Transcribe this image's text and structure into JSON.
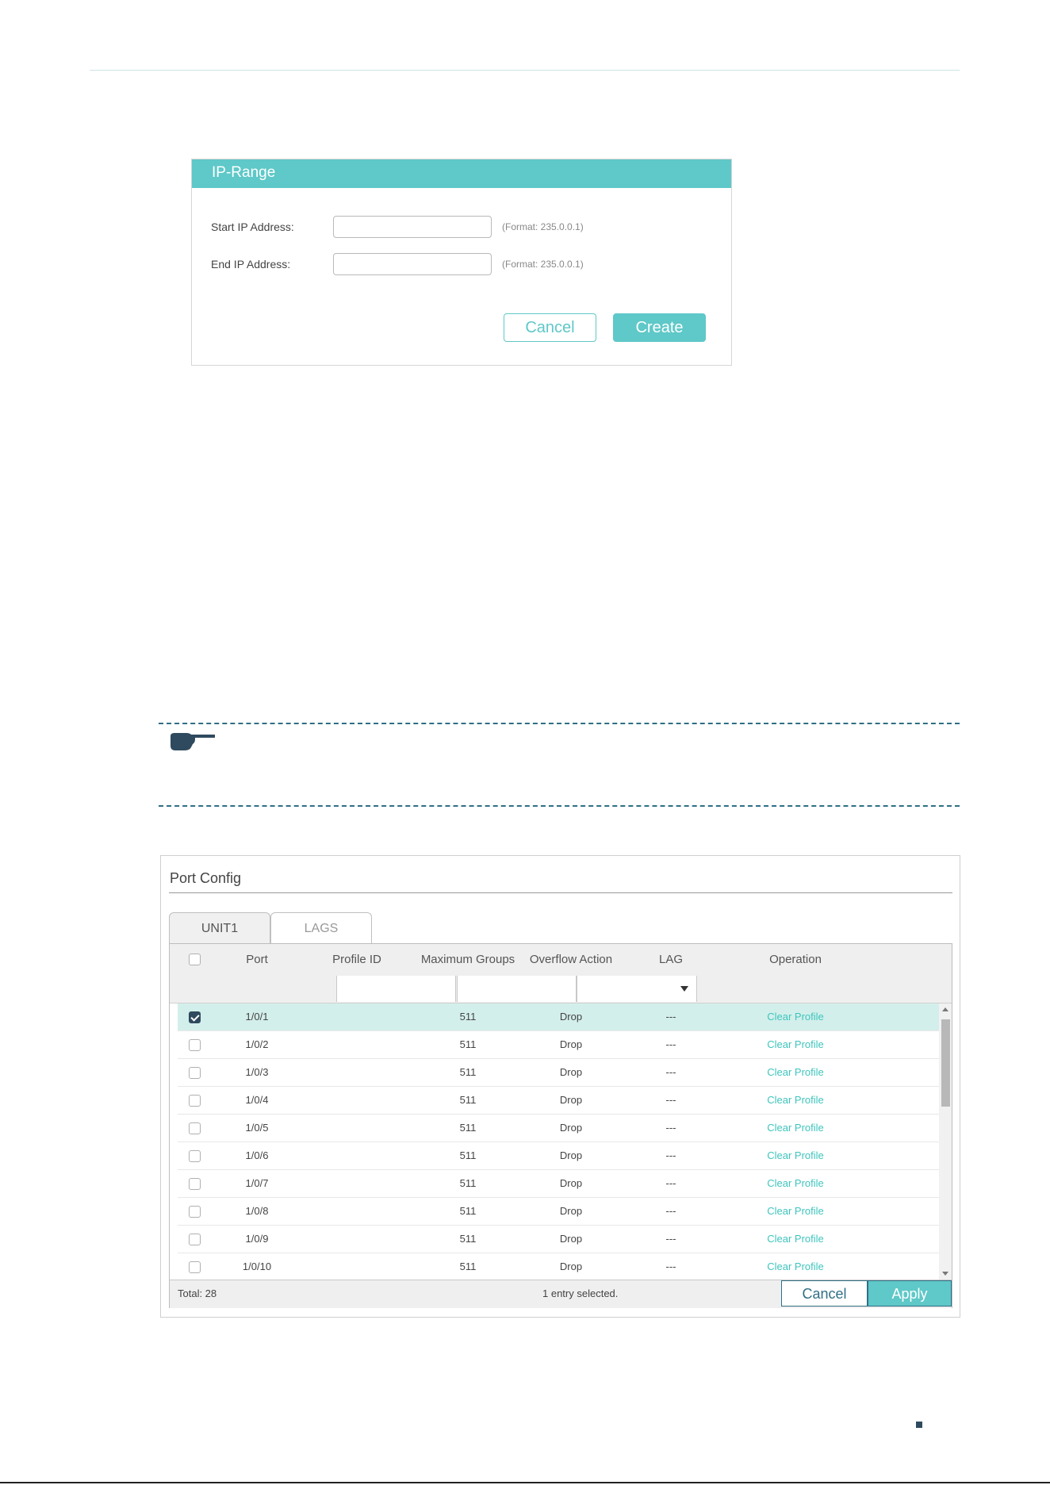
{
  "ip_range": {
    "title": "IP-Range",
    "start_label": "Start IP Address:",
    "end_label": "End IP Address:",
    "start_value": "",
    "end_value": "",
    "start_hint": "(Format: 235.0.0.1)",
    "end_hint": "(Format: 235.0.0.1)",
    "cancel_label": "Cancel",
    "create_label": "Create"
  },
  "note": {
    "icon": "pointing-hand-icon"
  },
  "port_config": {
    "title": "Port Config",
    "tabs": [
      {
        "label": "UNIT1",
        "active": true
      },
      {
        "label": "LAGS",
        "active": false
      }
    ],
    "columns": [
      "Port",
      "Profile ID",
      "Maximum Groups",
      "Overflow Action",
      "LAG",
      "Operation"
    ],
    "rows": [
      {
        "port": "1/0/1",
        "profile_id": "",
        "max_groups": "511",
        "overflow": "Drop",
        "lag": "---",
        "operation": "Clear Profile",
        "checked": true
      },
      {
        "port": "1/0/2",
        "profile_id": "",
        "max_groups": "511",
        "overflow": "Drop",
        "lag": "---",
        "operation": "Clear Profile",
        "checked": false
      },
      {
        "port": "1/0/3",
        "profile_id": "",
        "max_groups": "511",
        "overflow": "Drop",
        "lag": "---",
        "operation": "Clear Profile",
        "checked": false
      },
      {
        "port": "1/0/4",
        "profile_id": "",
        "max_groups": "511",
        "overflow": "Drop",
        "lag": "---",
        "operation": "Clear Profile",
        "checked": false
      },
      {
        "port": "1/0/5",
        "profile_id": "",
        "max_groups": "511",
        "overflow": "Drop",
        "lag": "---",
        "operation": "Clear Profile",
        "checked": false
      },
      {
        "port": "1/0/6",
        "profile_id": "",
        "max_groups": "511",
        "overflow": "Drop",
        "lag": "---",
        "operation": "Clear Profile",
        "checked": false
      },
      {
        "port": "1/0/7",
        "profile_id": "",
        "max_groups": "511",
        "overflow": "Drop",
        "lag": "---",
        "operation": "Clear Profile",
        "checked": false
      },
      {
        "port": "1/0/8",
        "profile_id": "",
        "max_groups": "511",
        "overflow": "Drop",
        "lag": "---",
        "operation": "Clear Profile",
        "checked": false
      },
      {
        "port": "1/0/9",
        "profile_id": "",
        "max_groups": "511",
        "overflow": "Drop",
        "lag": "---",
        "operation": "Clear Profile",
        "checked": false
      },
      {
        "port": "1/0/10",
        "profile_id": "",
        "max_groups": "511",
        "overflow": "Drop",
        "lag": "---",
        "operation": "Clear Profile",
        "checked": false
      }
    ],
    "footer": {
      "total": "Total: 28",
      "selected": "1 entry selected.",
      "cancel_label": "Cancel",
      "apply_label": "Apply"
    }
  },
  "colors": {
    "accent": "#5fc8c8",
    "dark": "#2f4a5e",
    "selected_row": "#d3efeb",
    "link": "#3fc5bd"
  }
}
